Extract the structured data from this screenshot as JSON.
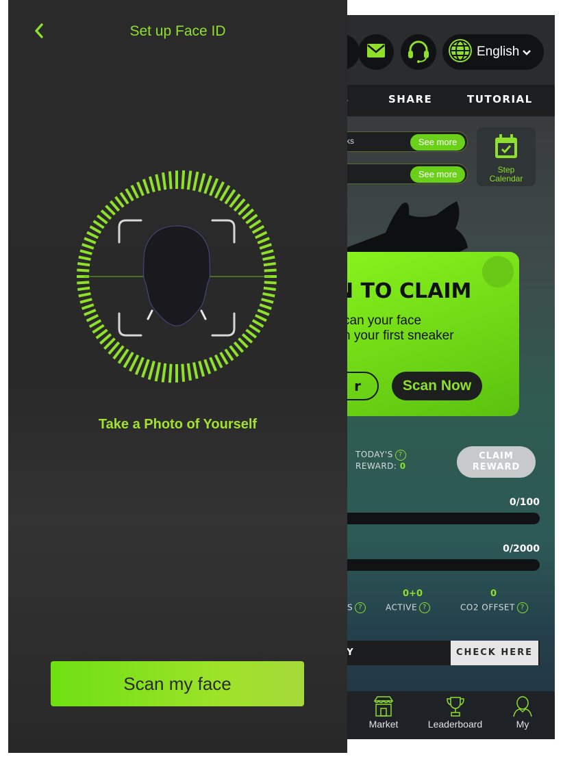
{
  "face_id": {
    "title": "Set up Face ID",
    "back_icon": "chevron-left-icon",
    "instruction": "Take a Photo of Yourself",
    "scan_button_label": "Scan my face",
    "accent_color": "#8ee02a"
  },
  "background_app": {
    "header": {
      "mail_icon": "mail-icon",
      "support_icon": "headset-icon",
      "language_icon": "globe-icon",
      "language_label": "English"
    },
    "tabs": [
      "B",
      "SHARE",
      "TUTORIAL"
    ],
    "notices": [
      {
        "text": "ks",
        "button": "See more"
      },
      {
        "text": "",
        "button": "See more"
      }
    ],
    "step_calendar_label": "Step\nCalendar",
    "popup": {
      "title": "N TO CLAIM",
      "line1": "can your face",
      "line2": "n your first sneaker",
      "later_label": "r",
      "scan_now_label": "Scan Now"
    },
    "reward": {
      "label_line1": "TODAY'S",
      "label_line2": "REWARD:",
      "value": "0",
      "claim_label": "CLAIM\nREWARD"
    },
    "progress": [
      {
        "label": "0/100",
        "fraction": 0
      },
      {
        "label": "0/2000",
        "fraction": 0
      }
    ],
    "stats": {
      "first_label": "S",
      "active_value": "0+0",
      "active_label": "ACTIVE",
      "co2_value": "0",
      "co2_label": "CO2 OFFSET",
      "help_glyph": "?"
    },
    "history": {
      "label": "RY",
      "check_label": "CHECK HERE"
    },
    "bottom_nav": [
      {
        "label": "Market",
        "icon": "shop-icon"
      },
      {
        "label": "Leaderboard",
        "icon": "trophy-icon"
      },
      {
        "label": "My",
        "icon": "user-icon"
      }
    ]
  }
}
